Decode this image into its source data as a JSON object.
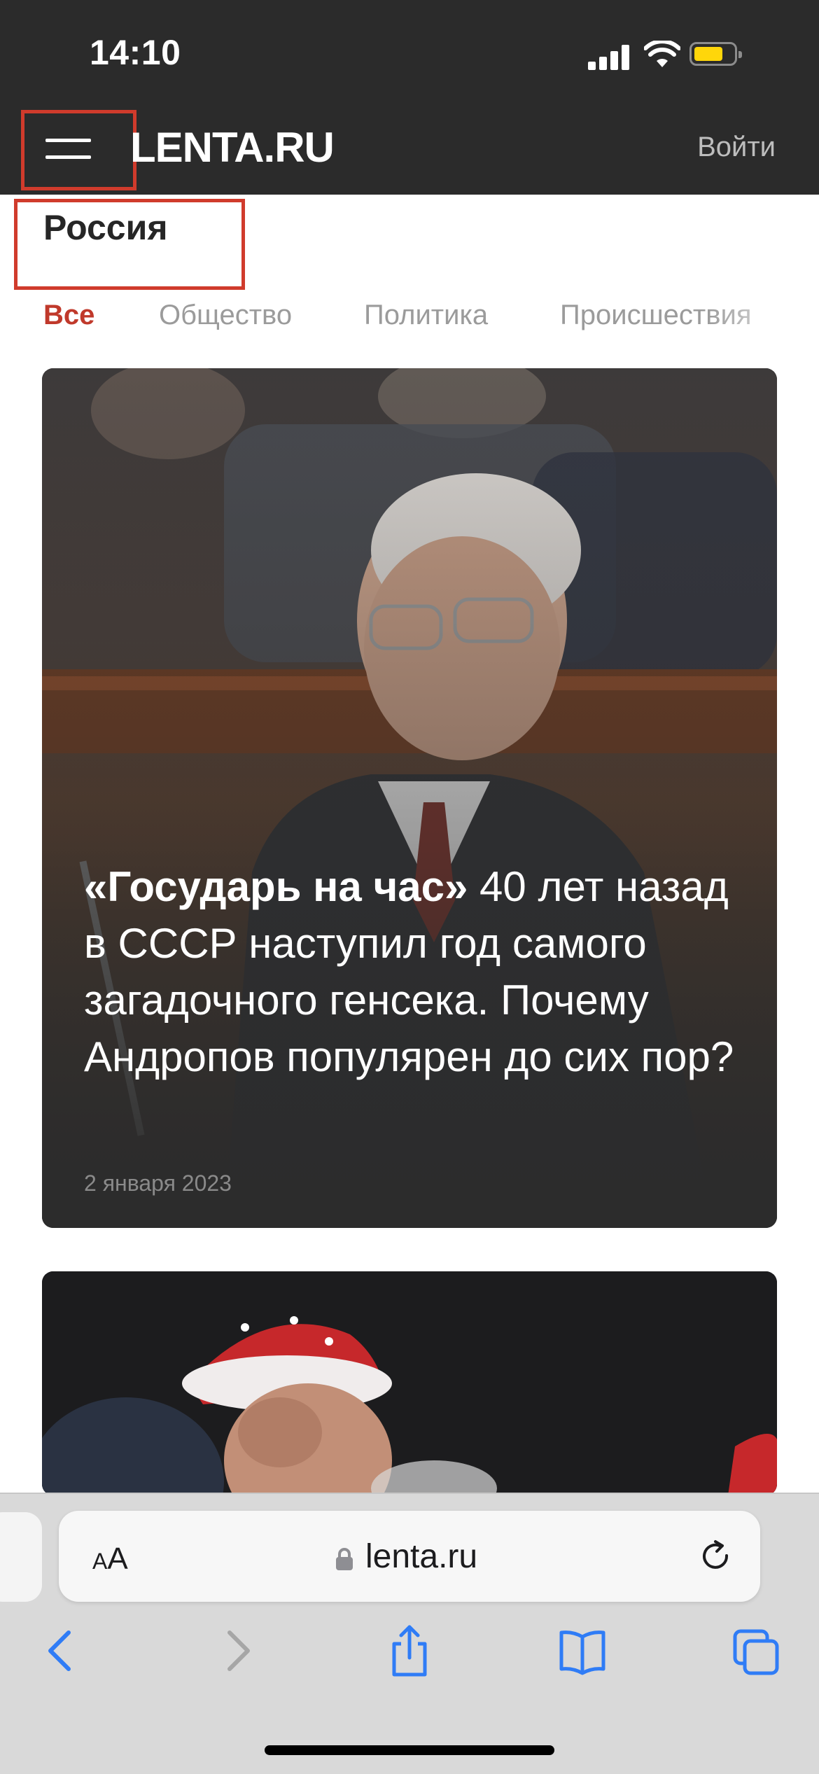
{
  "status_bar": {
    "time": "14:10"
  },
  "header": {
    "logo": "LENTA.RU",
    "login_label": "Войти"
  },
  "section": {
    "title": "Россия",
    "tabs": [
      {
        "label": "Все",
        "active": true
      },
      {
        "label": "Общество",
        "active": false
      },
      {
        "label": "Политика",
        "active": false
      },
      {
        "label": "Происшествия",
        "active": false
      }
    ]
  },
  "articles": [
    {
      "title_bold": "«Государь на час»",
      "title_rest": " 40 лет назад в СССР наступил год самого загадочного генсека. Почему Андропов популярен до сих пор?",
      "date": "2 января 2023"
    }
  ],
  "browser": {
    "text_size_small": "A",
    "text_size_big": "A",
    "url": "lenta.ru"
  },
  "colors": {
    "accent": "#c0392b",
    "highlight_box": "#d03b2c",
    "header_bg": "#2b2b2b",
    "safari_blue": "#2f7cf6"
  }
}
